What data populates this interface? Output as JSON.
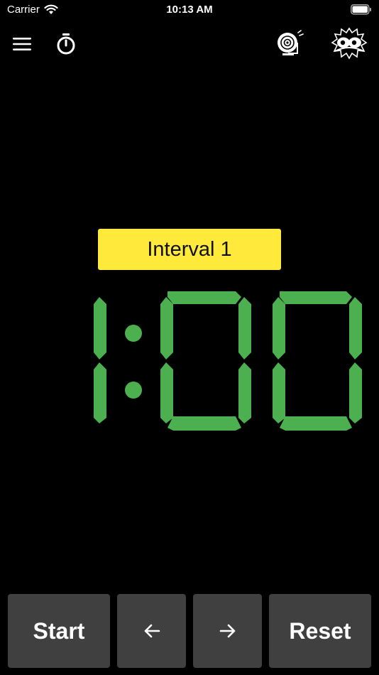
{
  "status_bar": {
    "carrier": "Carrier",
    "time": "10:13 AM",
    "wifi_icon": "wifi-icon",
    "battery_icon": "battery-icon"
  },
  "toolbar": {
    "menu_icon": "hamburger-menu-icon",
    "stopwatch_icon": "stopwatch-icon",
    "bell_icon": "alarm-bell-icon",
    "boxing_icon": "boxing-gloves-icon"
  },
  "interval": {
    "label": "Interval 1"
  },
  "timer": {
    "minutes": "1",
    "seconds": "00",
    "color": "#4caf50"
  },
  "controls": {
    "start_label": "Start",
    "prev_label": "←",
    "next_label": "→",
    "reset_label": "Reset"
  },
  "colors": {
    "background": "#000000",
    "label_bg": "#ffe93b",
    "button_bg": "#404040",
    "digit": "#4caf50"
  }
}
